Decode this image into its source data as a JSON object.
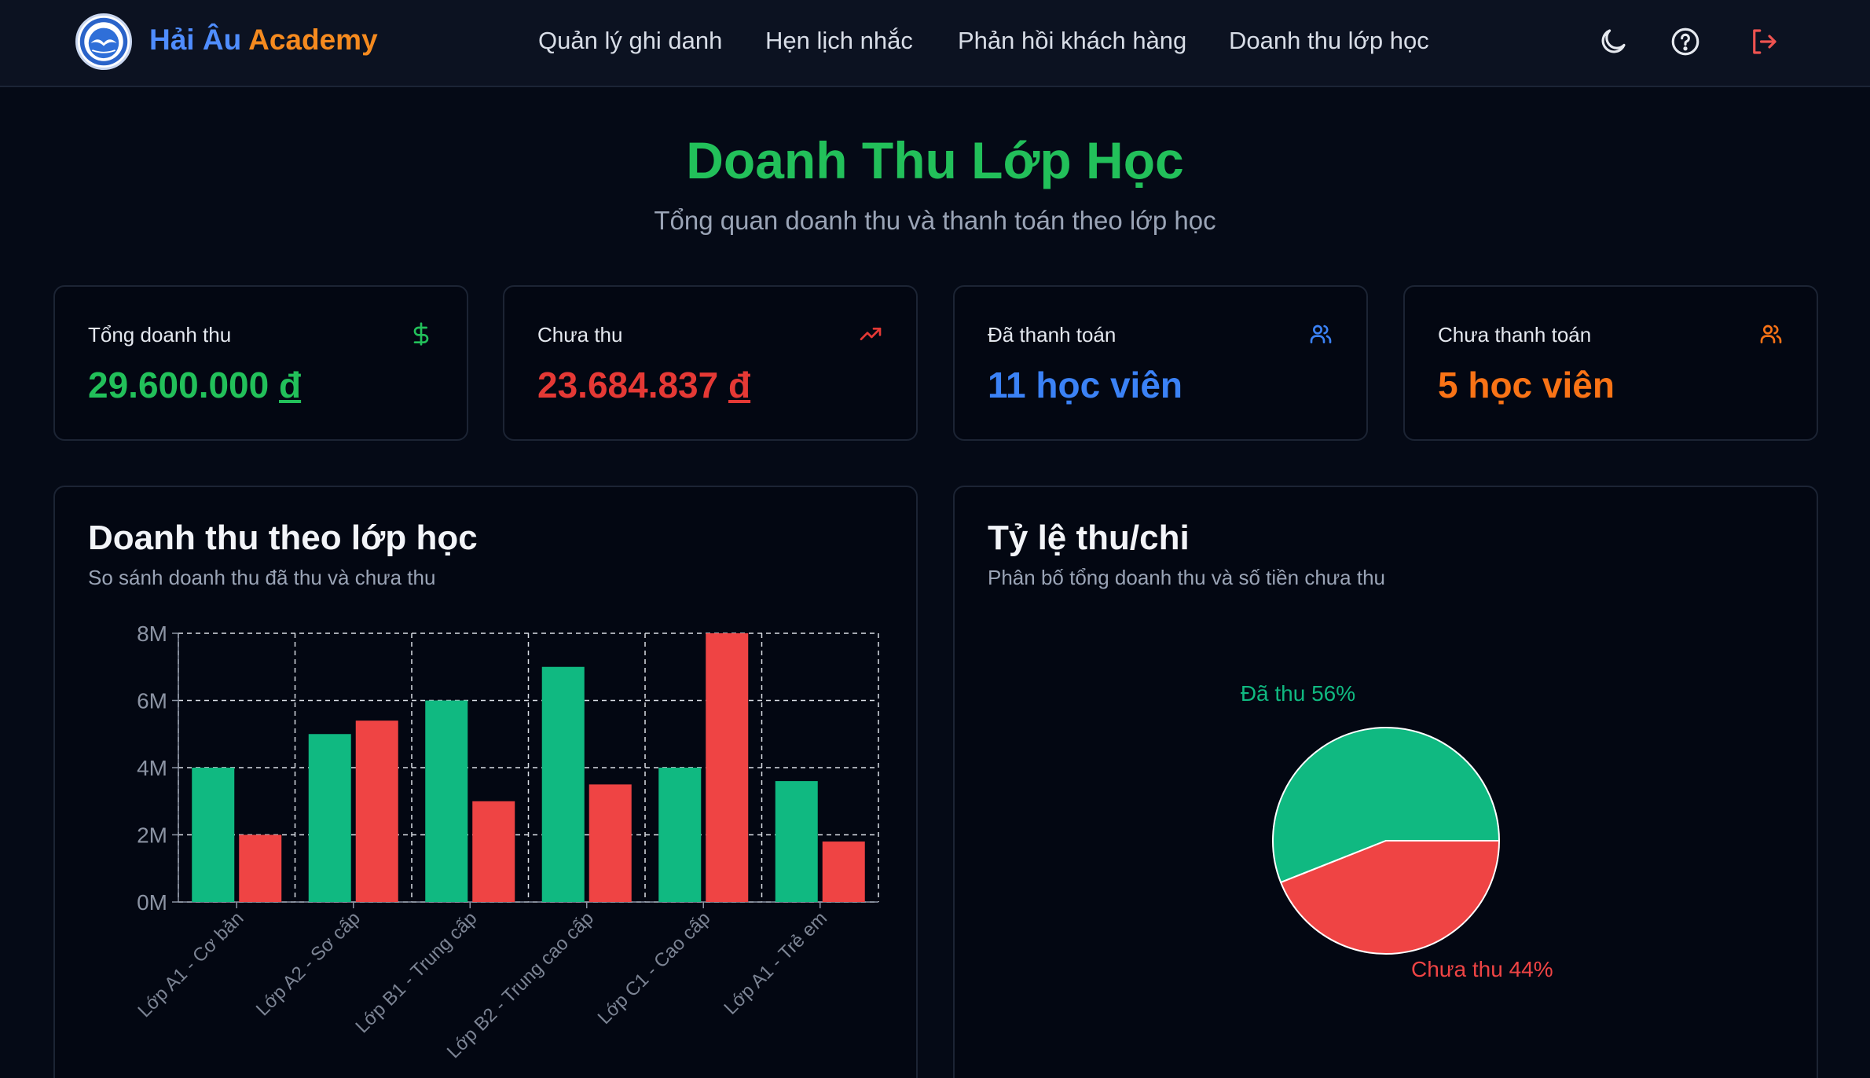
{
  "brand": {
    "name_part1": "Hải Âu",
    "name_part2": "Academy"
  },
  "nav": {
    "links": [
      "Quản lý ghi danh",
      "Hẹn lịch nhắc",
      "Phản hồi khách hàng",
      "Doanh thu lớp học"
    ],
    "icons": [
      "moon-icon",
      "help-circle-icon",
      "logout-icon"
    ]
  },
  "header": {
    "title": "Doanh Thu Lớp Học",
    "subtitle": "Tổng quan doanh thu và thanh toán theo lớp học"
  },
  "stats": [
    {
      "label": "Tổng doanh thu",
      "value": "29.600.000",
      "currency": "đ",
      "icon": "dollar-icon",
      "color": "#22c05a"
    },
    {
      "label": "Chưa thu",
      "value": "23.684.837",
      "currency": "đ",
      "icon": "trending-up-icon",
      "color": "#e53935"
    },
    {
      "label": "Đã thanh toán",
      "value": "11 học viên",
      "icon": "users-icon",
      "color": "#3b82f6"
    },
    {
      "label": "Chưa thanh toán",
      "value": "5 học viên",
      "icon": "users-icon",
      "color": "#f97316"
    }
  ],
  "panels": {
    "bar": {
      "title": "Doanh thu theo lớp học",
      "subtitle": "So sánh doanh thu đã thu và chưa thu"
    },
    "pie": {
      "title": "Tỷ lệ thu/chi",
      "subtitle": "Phân bố tổng doanh thu và số tiền chưa thu"
    }
  },
  "chart_data": [
    {
      "type": "bar",
      "categories": [
        "Lớp A1 - Cơ bản",
        "Lớp A2 - Sơ cấp",
        "Lớp B1 - Trung cấp",
        "Lớp B2 - Trung cao cấp",
        "Lớp C1 - Cao cấp",
        "Lớp A1 - Trẻ em"
      ],
      "series": [
        {
          "values": [
            4000000,
            5000000,
            6000000,
            7000000,
            4000000,
            3600000
          ],
          "color": "#10b981"
        },
        {
          "values": [
            2000000,
            5400000,
            3000000,
            3500000,
            8000000,
            1800000
          ],
          "color": "#ef4444"
        }
      ],
      "yticks": [
        "0M",
        "2M",
        "4M",
        "6M",
        "8M"
      ],
      "ylim": [
        0,
        8000000
      ],
      "grid": true,
      "title": "",
      "xlabel": "",
      "ylabel": ""
    },
    {
      "type": "pie",
      "slices": [
        {
          "label": "Đã thu 56%",
          "value": 56,
          "color": "#10b981"
        },
        {
          "label": "Chưa thu 44%",
          "value": 44,
          "color": "#ef4444"
        }
      ]
    }
  ]
}
